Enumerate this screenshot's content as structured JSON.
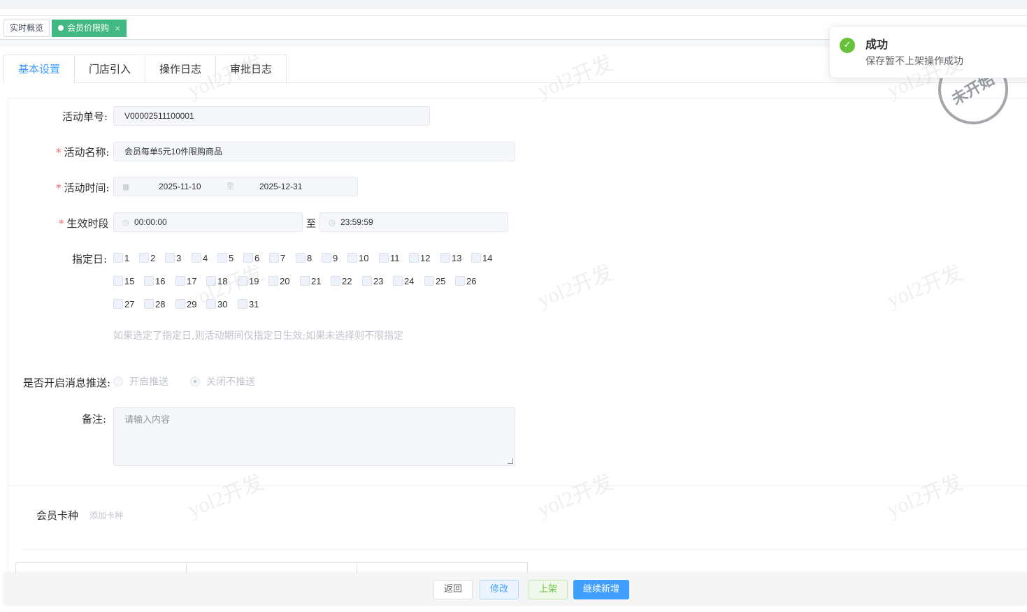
{
  "page_tabs": {
    "overview": "实时概览",
    "active_tab": "会员价限购",
    "close": "×"
  },
  "tabs": [
    "基本设置",
    "门店引入",
    "操作日志",
    "审批日志"
  ],
  "form": {
    "activity_no_label": "活动单号:",
    "activity_no": "V00002511100001",
    "activity_name_label": "活动名称:",
    "activity_name": "会员每单5元10件限购商品",
    "activity_time_label": "活动时间:",
    "start_date": "2025-11-10",
    "date_sep": "至",
    "end_date": "2025-12-31",
    "period_label": "生效时段",
    "start_time": "00:00:00",
    "time_sep": "至",
    "end_time": "23:59:59",
    "days_label": "指定日:",
    "days": [
      "1",
      "2",
      "3",
      "4",
      "5",
      "6",
      "7",
      "8",
      "9",
      "10",
      "11",
      "12",
      "13",
      "14",
      "15",
      "16",
      "17",
      "18",
      "19",
      "20",
      "21",
      "22",
      "23",
      "24",
      "25",
      "26",
      "27",
      "28",
      "29",
      "30",
      "31"
    ],
    "days_hint": "如果选定了指定日,则活动期间仅指定日生效;如果未选择则不限指定",
    "push_label": "是否开启消息推送:",
    "push_on": "开启推送",
    "push_off": "关闭不推送",
    "remark_label": "备注:",
    "remark_placeholder": "请输入内容"
  },
  "card_section": {
    "title": "会员卡种",
    "add_link": "添加卡种"
  },
  "footer": {
    "back": "返回",
    "edit": "修改",
    "list": "上架",
    "continue": "继续新增"
  },
  "toast": {
    "title": "成功",
    "message": "保存暂不上架操作成功"
  },
  "stamp": "未开始",
  "watermark": "yol2开发",
  "colors": {
    "primary": "#409eff",
    "success": "#67c23a",
    "active_tab": "#42b983",
    "danger": "#f56c6c"
  }
}
